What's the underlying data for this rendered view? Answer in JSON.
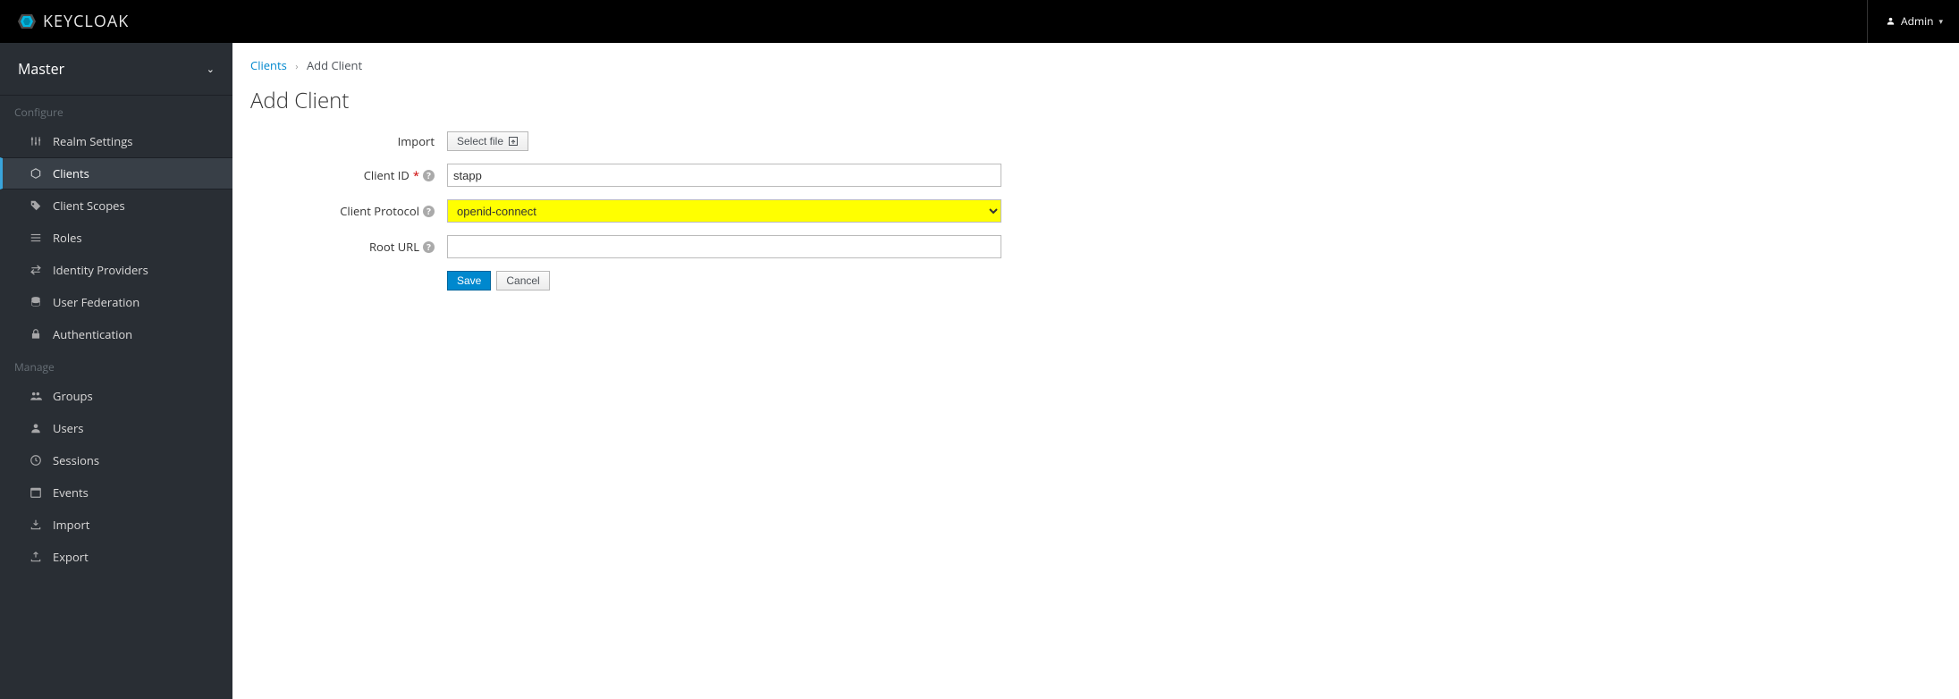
{
  "header": {
    "brand": "KEYCLOAK",
    "user_label": "Admin"
  },
  "sidebar": {
    "realm": "Master",
    "section_configure": "Configure",
    "section_manage": "Manage",
    "items_configure": [
      "Realm Settings",
      "Clients",
      "Client Scopes",
      "Roles",
      "Identity Providers",
      "User Federation",
      "Authentication"
    ],
    "items_manage": [
      "Groups",
      "Users",
      "Sessions",
      "Events",
      "Import",
      "Export"
    ]
  },
  "breadcrumb": {
    "root": "Clients",
    "current": "Add Client"
  },
  "page": {
    "title": "Add Client"
  },
  "form": {
    "import_label": "Import",
    "select_file_label": "Select file",
    "client_id_label": "Client ID",
    "client_id_value": "stapp",
    "client_protocol_label": "Client Protocol",
    "client_protocol_value": "openid-connect",
    "root_url_label": "Root URL",
    "root_url_value": "",
    "save_label": "Save",
    "cancel_label": "Cancel"
  }
}
